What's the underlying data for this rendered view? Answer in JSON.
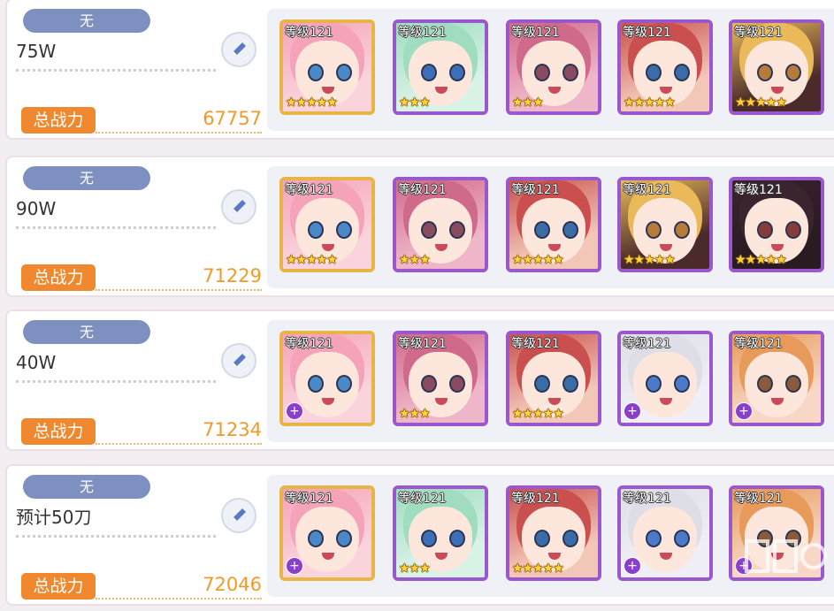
{
  "teams": [
    {
      "tag": "无",
      "note": "75W",
      "power_label": "总战力",
      "power": "67757",
      "characters": [
        {
          "level": "等级121",
          "stars": "★★★★★",
          "rarity": "gold",
          "plus": false,
          "hair": "#f4a3b8",
          "bg": "#fbd3dc",
          "eye": "#4a88c8"
        },
        {
          "level": "等级121",
          "stars": "★★★",
          "rarity": "purple",
          "plus": false,
          "hair": "#9fdcc0",
          "bg": "#d8f2e6",
          "eye": "#3d6fb8"
        },
        {
          "level": "等级121",
          "stars": "★★★",
          "rarity": "purple",
          "plus": false,
          "hair": "#d06a8a",
          "bg": "#efb5c8",
          "eye": "#8a4a60"
        },
        {
          "level": "等级121",
          "stars": "★★★★★",
          "rarity": "purple",
          "plus": false,
          "hair": "#c9504f",
          "bg": "#f3c7b7",
          "eye": "#3a6da8"
        },
        {
          "level": "等级121",
          "stars": "★★★★★",
          "rarity": "purple",
          "plus": false,
          "hair": "#e9b95a",
          "bg": "#4a2a2a",
          "eye": "#b87a3a"
        }
      ]
    },
    {
      "tag": "无",
      "note": "90W",
      "power_label": "总战力",
      "power": "71229",
      "characters": [
        {
          "level": "等级121",
          "stars": "★★★★★",
          "rarity": "gold",
          "plus": false,
          "hair": "#f4a3b8",
          "bg": "#fbd3dc",
          "eye": "#4a88c8"
        },
        {
          "level": "等级121",
          "stars": "★★★",
          "rarity": "purple",
          "plus": false,
          "hair": "#d06a8a",
          "bg": "#efb5c8",
          "eye": "#8a4a60"
        },
        {
          "level": "等级121",
          "stars": "★★★★★",
          "rarity": "purple",
          "plus": false,
          "hair": "#c9504f",
          "bg": "#f3c7b7",
          "eye": "#3a6da8"
        },
        {
          "level": "等级121",
          "stars": "★★★★★",
          "rarity": "purple",
          "plus": false,
          "hair": "#e9b95a",
          "bg": "#4a2a2a",
          "eye": "#b87a3a"
        },
        {
          "level": "等级121",
          "stars": "★★★★★",
          "rarity": "purple",
          "plus": false,
          "hair": "#3a2430",
          "bg": "#2a1a22",
          "eye": "#8a3a3a"
        }
      ]
    },
    {
      "tag": "无",
      "note": "40W",
      "power_label": "总战力",
      "power": "71234",
      "characters": [
        {
          "level": "等级121",
          "stars": "",
          "rarity": "gold",
          "plus": true,
          "hair": "#f4a3b8",
          "bg": "#fbd3dc",
          "eye": "#4a88c8"
        },
        {
          "level": "等级121",
          "stars": "★★★",
          "rarity": "purple",
          "plus": false,
          "hair": "#d06a8a",
          "bg": "#efb5c8",
          "eye": "#8a4a60"
        },
        {
          "level": "等级121",
          "stars": "★★★★★",
          "rarity": "purple",
          "plus": false,
          "hair": "#c9504f",
          "bg": "#f3c7b7",
          "eye": "#3a6da8"
        },
        {
          "level": "等级121",
          "stars": "",
          "rarity": "purple",
          "plus": true,
          "hair": "#dedfe6",
          "bg": "#f0eef6",
          "eye": "#4a7ac8"
        },
        {
          "level": "等级121",
          "stars": "",
          "rarity": "purple",
          "plus": true,
          "hair": "#e89a5a",
          "bg": "#f8d7c6",
          "eye": "#8a5a3a"
        }
      ]
    },
    {
      "tag": "无",
      "note": "预计50刀",
      "power_label": "总战力",
      "power": "72046",
      "characters": [
        {
          "level": "等级121",
          "stars": "",
          "rarity": "gold",
          "plus": true,
          "hair": "#f4a3b8",
          "bg": "#fbd3dc",
          "eye": "#4a88c8"
        },
        {
          "level": "等级121",
          "stars": "★★★",
          "rarity": "purple",
          "plus": false,
          "hair": "#9fdcc0",
          "bg": "#d8f2e6",
          "eye": "#3d6fb8"
        },
        {
          "level": "等级121",
          "stars": "★★★★★",
          "rarity": "purple",
          "plus": false,
          "hair": "#c9504f",
          "bg": "#f3c7b7",
          "eye": "#3a6da8"
        },
        {
          "level": "等级121",
          "stars": "",
          "rarity": "purple",
          "plus": true,
          "hair": "#dedfe6",
          "bg": "#f0eef6",
          "eye": "#4a7ac8"
        },
        {
          "level": "等级121",
          "stars": "",
          "rarity": "purple",
          "plus": true,
          "hair": "#e89a5a",
          "bg": "#f8d7c6",
          "eye": "#8a5a3a"
        }
      ]
    }
  ]
}
